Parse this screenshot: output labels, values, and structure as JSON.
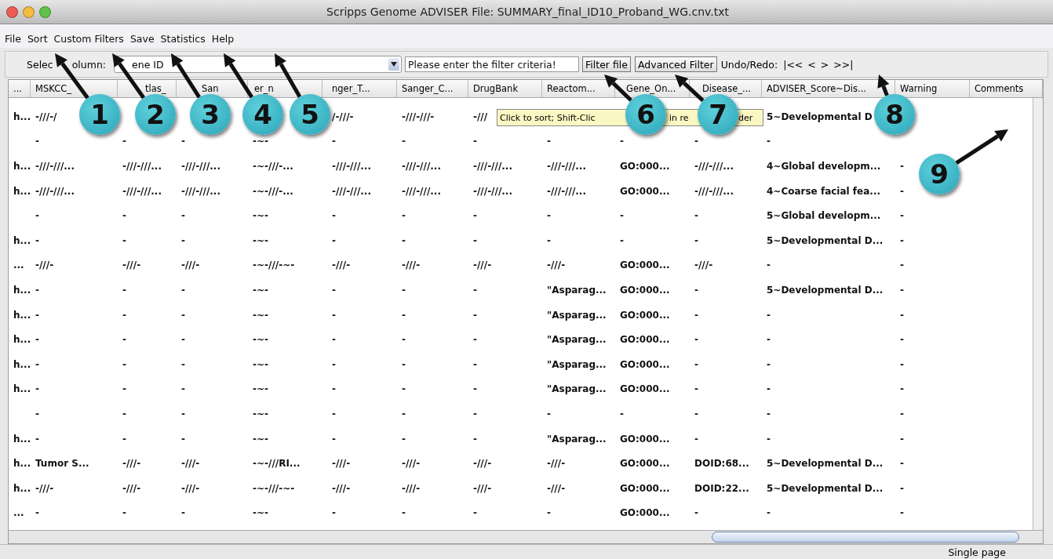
{
  "window": {
    "title": "Scripps Genome ADVISER File: SUMMARY_final_ID10_Proband_WG.cnv.txt"
  },
  "menu": [
    "File",
    "Sort",
    "Custom Filters",
    "Save",
    "Statistics",
    "Help"
  ],
  "toolbar": {
    "column_label": [
      "Selec",
      "olumn:"
    ],
    "column_value": "ene ID",
    "filter": {
      "value": "Please enter the filter criteria!"
    },
    "buttons": [
      "Filter file",
      "Advanced Filter"
    ],
    "undo_label": "Undo/Redo:",
    "history_buttons": [
      "|<<",
      "<",
      ">",
      ">>|"
    ]
  },
  "table": {
    "columns": [
      "...",
      "MSKCC_",
      "tlas_",
      "San",
      "er_n",
      "nger_T...",
      "Sanger_C...",
      "DrugBank",
      "Reactom...",
      "Gene_On...",
      "Disease_...",
      "ADVISER_Score~Dis...",
      "Warning",
      "Comments"
    ],
    "rows": [
      [
        "h...",
        "-///-/",
        null,
        null,
        null,
        "/-///-",
        "-///-///-",
        "-///",
        null,
        null,
        null,
        "5~Developmental D",
        null,
        null
      ],
      [
        null,
        "-",
        "-",
        "-",
        "-~-",
        "-",
        "-",
        "-",
        "-",
        "-",
        "-",
        "-",
        null,
        null
      ],
      [
        "h...",
        "-///-///...",
        "-///-///...",
        "-///-///...",
        "-~-///-...",
        "-///-///...",
        "-///-///...",
        "-///-///...",
        "-///-///...",
        "GO:000...",
        "-///-///...",
        "4~Global developm...",
        "-",
        null
      ],
      [
        "h...",
        "-///-///...",
        "-///-///...",
        "-///-///...",
        "-~-///-...",
        "-///-///...",
        "-///-///...",
        "-///-///...",
        "-///-///...",
        "GO:000...",
        "-///-///...",
        "4~Coarse facial fea...",
        "-",
        null
      ],
      [
        null,
        "-",
        "-",
        "-",
        "-~-",
        "-",
        "-",
        "-",
        "-",
        "-",
        "-",
        "5~Global developm...",
        "-",
        null
      ],
      [
        "h...",
        "-",
        "-",
        "-",
        "-~-",
        "-",
        "-",
        "-",
        "-",
        "-",
        "-",
        "5~Developmental D...",
        "-",
        null
      ],
      [
        "...",
        "-///-",
        "-///-",
        "-///-",
        "-~-///-~-",
        "-///-",
        "-///-",
        "-///-",
        "-///-",
        "GO:000...",
        "-///-",
        "-",
        "-",
        null
      ],
      [
        "h...",
        "-",
        "-",
        "-",
        "-~-",
        "-",
        "-",
        "-",
        "\"Asparag...",
        "GO:000...",
        "-",
        "5~Developmental D...",
        "-",
        null
      ],
      [
        "h...",
        "-",
        "-",
        "-",
        "-~-",
        "-",
        "-",
        "-",
        "\"Asparag...",
        "GO:000...",
        "-",
        "-",
        "-",
        null
      ],
      [
        "h...",
        "-",
        "-",
        "-",
        "-~-",
        "-",
        "-",
        "-",
        "\"Asparag...",
        "GO:000...",
        "-",
        "-",
        "-",
        null
      ],
      [
        "h...",
        "-",
        "-",
        "-",
        "-~-",
        "-",
        "-",
        "-",
        "\"Asparag...",
        "GO:000...",
        "-",
        "-",
        "-",
        null
      ],
      [
        "h...",
        "-",
        "-",
        "-",
        "-~-",
        "-",
        "-",
        "-",
        "\"Asparag...",
        "GO:000...",
        "-",
        "-",
        "-",
        null
      ],
      [
        null,
        "-",
        "-",
        "-",
        "-~-",
        "-",
        "-",
        "-",
        "-",
        "-",
        "-",
        "-",
        "-",
        null
      ],
      [
        "h...",
        "-",
        "-",
        "-",
        "-~-",
        "-",
        "-",
        "-",
        "\"Asparag...",
        "GO:000...",
        "-",
        "-",
        "-",
        null
      ],
      [
        "h...",
        "Tumor S...",
        "-///-",
        "-///-",
        "-~-///RI...",
        "-///-",
        "-///-",
        "-///-",
        "-///-",
        "GO:000...",
        "DOID:68...",
        "5~Developmental D...",
        "-",
        null
      ],
      [
        "h...",
        "-///-",
        "-///-",
        "-///-",
        "-~-///-~-",
        "-///-",
        "-///-",
        "-///-",
        "-///-",
        "GO:000...",
        "DOID:22...",
        "5~Developmental D...",
        "-",
        null
      ],
      [
        "...",
        "-",
        "-",
        "-",
        "-~-",
        "-",
        "-",
        "-",
        "-",
        "GO:000...",
        "-",
        "-",
        "-",
        null
      ]
    ]
  },
  "tooltip": [
    "Click to sort; Shift-Clic",
    "in re",
    "der"
  ],
  "status_bar": "Single page",
  "callouts": [
    "1",
    "2",
    "3",
    "4",
    "5",
    "6",
    "7",
    "8",
    "9"
  ]
}
